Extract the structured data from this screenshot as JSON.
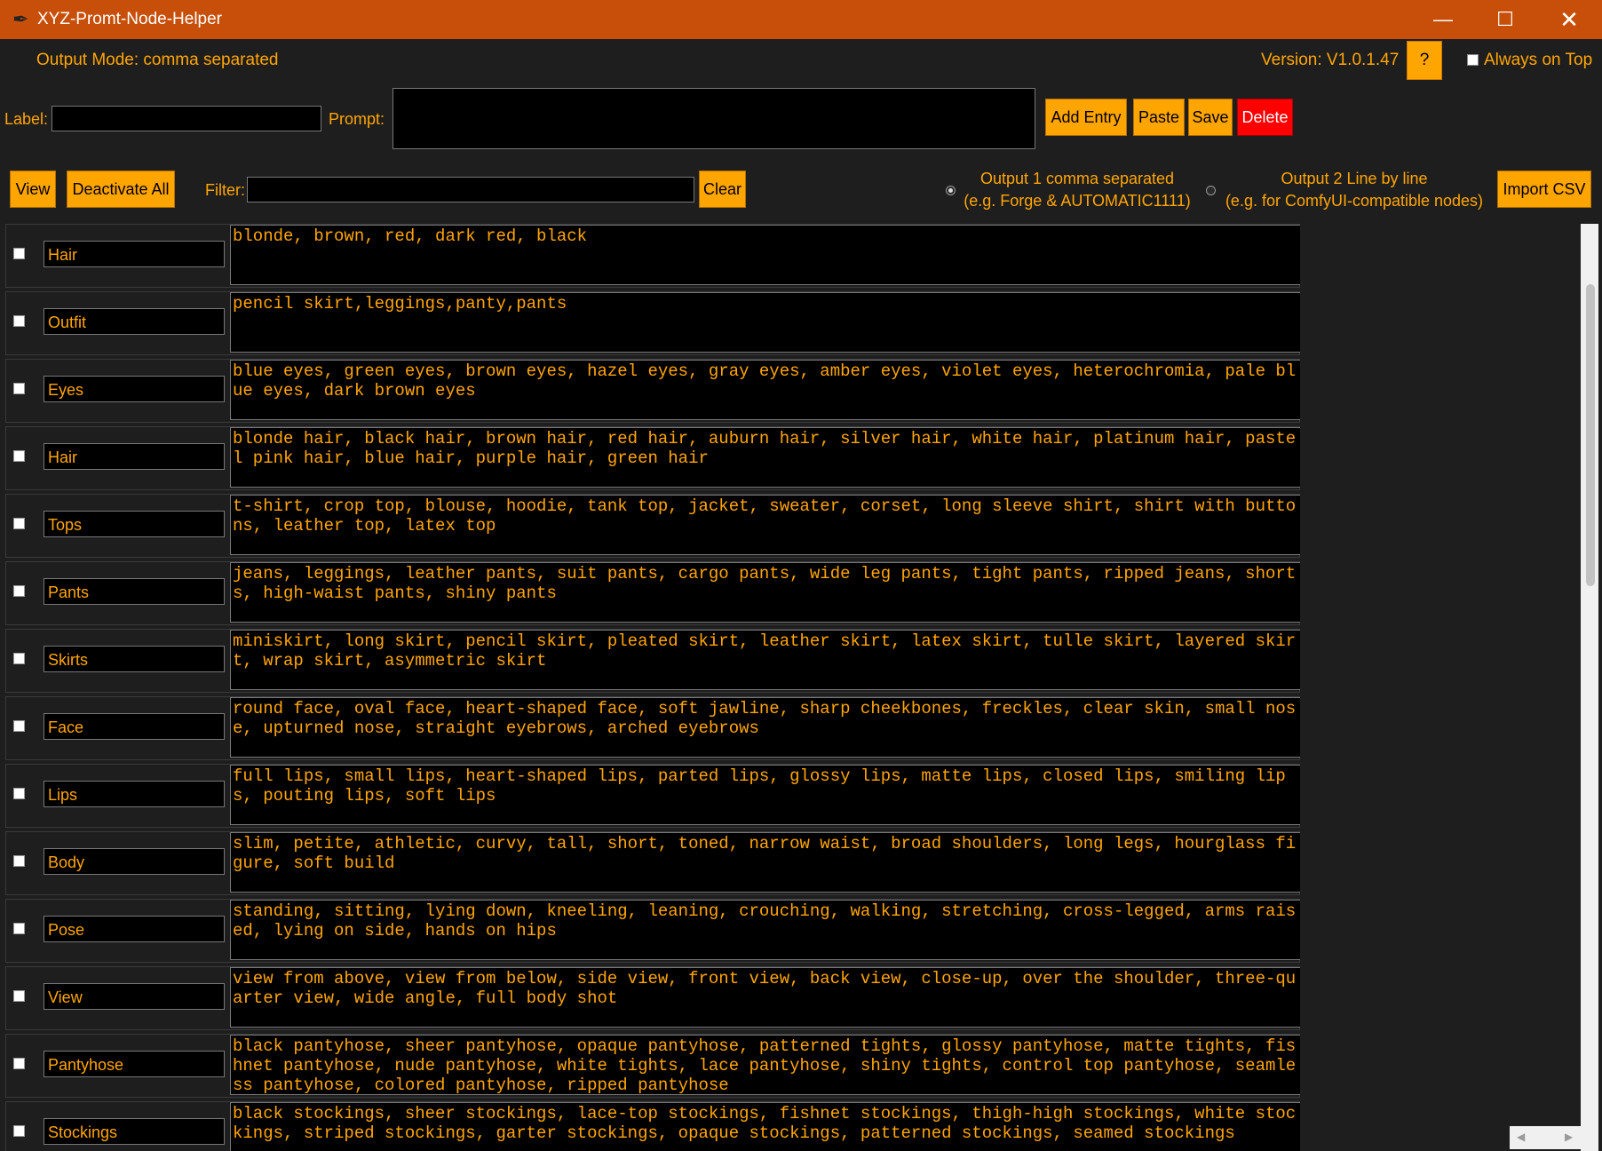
{
  "window": {
    "title": "XYZ-Promt-Node-Helper",
    "controls": {
      "minimize": "—",
      "maximize": "☐",
      "close": "✕"
    }
  },
  "header": {
    "output_mode": "Output Mode: comma separated",
    "version": "Version: V1.0.1.47",
    "help_label": "?",
    "always_on_top": "Always on Top"
  },
  "entry": {
    "label_caption": "Label:",
    "label_value": "",
    "prompt_caption": "Prompt:",
    "prompt_value": "",
    "add_entry": "Add Entry",
    "paste": "Paste",
    "save": "Save",
    "delete": "Delete"
  },
  "toolbar": {
    "view": "View",
    "deactivate_all": "Deactivate All",
    "filter_caption": "Filter:",
    "filter_value": "",
    "clear": "Clear",
    "output1_line1": "Output 1 comma separated",
    "output1_line2": "(e.g. Forge & AUTOMATIC1111)",
    "output2_line1": "Output 2 Line by line",
    "output2_line2": "(e.g. for ComfyUI-compatible nodes)",
    "import_csv": "Import CSV"
  },
  "entries": [
    {
      "label": "Hair",
      "prompt": "blonde, brown, red, dark red, black"
    },
    {
      "label": "Outfit",
      "prompt": "pencil skirt,leggings,panty,pants"
    },
    {
      "label": "Eyes",
      "prompt": "blue eyes, green eyes, brown eyes, hazel eyes, gray eyes, amber eyes, violet eyes, heterochromia, pale blue eyes, dark brown eyes"
    },
    {
      "label": "Hair",
      "prompt": "blonde hair, black hair, brown hair, red hair, auburn hair, silver hair, white hair, platinum hair, pastel pink hair, blue hair, purple hair, green hair"
    },
    {
      "label": "Tops",
      "prompt": "t-shirt, crop top, blouse, hoodie, tank top, jacket, sweater, corset, long sleeve shirt, shirt with buttons, leather top, latex top"
    },
    {
      "label": "Pants",
      "prompt": "jeans, leggings, leather pants, suit pants, cargo pants, wide leg pants, tight pants, ripped jeans, shorts, high-waist pants, shiny pants"
    },
    {
      "label": "Skirts",
      "prompt": "miniskirt, long skirt, pencil skirt, pleated skirt, leather skirt, latex skirt, tulle skirt, layered skirt, wrap skirt, asymmetric skirt"
    },
    {
      "label": "Face",
      "prompt": "round face, oval face, heart-shaped face, soft jawline, sharp cheekbones, freckles, clear skin, small nose, upturned nose, straight eyebrows, arched eyebrows"
    },
    {
      "label": "Lips",
      "prompt": "full lips, small lips, heart-shaped lips, parted lips, glossy lips, matte lips, closed lips, smiling lips, pouting lips, soft lips"
    },
    {
      "label": "Body",
      "prompt": "slim, petite, athletic, curvy, tall, short, toned, narrow waist, broad shoulders, long legs, hourglass figure, soft build"
    },
    {
      "label": "Pose",
      "prompt": "standing, sitting, lying down, kneeling, leaning, crouching, walking, stretching, cross-legged, arms raised, lying on side, hands on hips"
    },
    {
      "label": "View",
      "prompt": "view from above, view from below, side view, front view, back view, close-up, over the shoulder, three-quarter view, wide angle, full body shot"
    },
    {
      "label": "Pantyhose",
      "prompt": "black pantyhose, sheer pantyhose, opaque pantyhose, patterned tights, glossy pantyhose, matte tights, fishnet pantyhose, nude pantyhose, white tights, lace pantyhose, shiny tights, control top pantyhose, seamless pantyhose, colored pantyhose, ripped pantyhose"
    },
    {
      "label": "Stockings",
      "prompt": "black stockings, sheer stockings, lace-top stockings, fishnet stockings, thigh-high stockings, white stockings, striped stockings, garter stockings, opaque stockings, patterned stockings, seamed stockings"
    }
  ],
  "colors": {
    "accent": "#ffa500",
    "titlebar": "#c84f0a",
    "delete": "#ff0000",
    "background": "#1e1e1e"
  }
}
